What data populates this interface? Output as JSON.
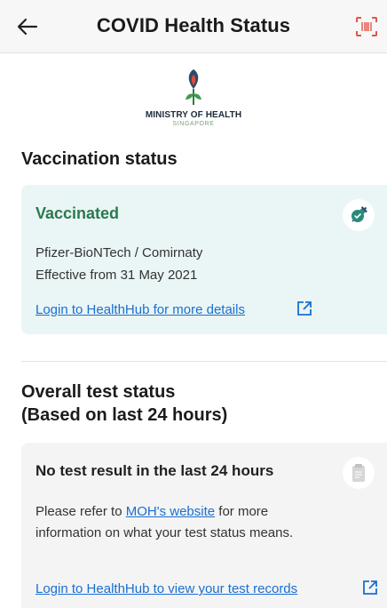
{
  "header": {
    "title": "COVID Health Status",
    "back_icon": "arrow-left-icon",
    "scan_icon": "scan-icon"
  },
  "moh": {
    "line1": "MINISTRY OF HEALTH",
    "line2": "SINGAPORE"
  },
  "vaccination": {
    "section_title": "Vaccination status",
    "status": "Vaccinated",
    "vaccine": "Pfizer-BioNTech / Comirnaty",
    "effective": "Effective from 31 May 2021",
    "link": "Login to HealthHub for more details",
    "icon": "syringe-icon",
    "colors": {
      "card_bg": "#eaf5f5",
      "status": "#2a7a4f"
    }
  },
  "test": {
    "section_title_line1": "Overall test status",
    "section_title_line2": "(Based on last 24 hours)",
    "status": "No test result in the last 24 hours",
    "body_before": "Please refer to ",
    "body_link": "MOH's website",
    "body_after": " for more information on what your test status means.",
    "link": "Login to HealthHub to view your test records",
    "icon": "clipboard-icon"
  },
  "colors": {
    "link": "#1a6fd0",
    "scan_icon": "#e2554a"
  }
}
